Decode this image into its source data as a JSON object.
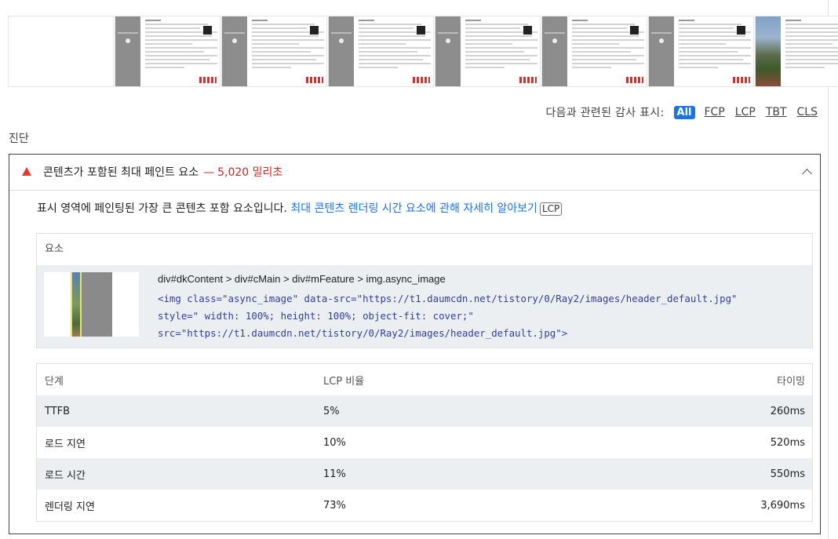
{
  "filter": {
    "label": "다음과 관련된 감사 표시:",
    "options": [
      "All",
      "FCP",
      "LCP",
      "TBT",
      "CLS"
    ]
  },
  "section_title": "진단",
  "audit": {
    "title": "콘텐츠가 포함된 최대 페인트 요소",
    "dash": "—",
    "value": "5,020 밀리초",
    "description": "표시 영역에 페인팅된 가장 큰 콘텐츠 포함 요소입니다.",
    "learn_more": "최대 콘텐츠 렌더링 시간 요소에 관해 자세히 알아보기",
    "badge": "LCP",
    "element_header": "요소",
    "element_path": "div#dkContent > div#cMain > div#mFeature > img.async_image",
    "element_code_1": "<img class=\"async_image\" data-src=\"https://t1.daumcdn.net/tistory/0/Ray2/images/header_default.jpg\"",
    "element_code_2": "style=\" width: 100%; height: 100%; object-fit: cover;\"",
    "element_code_3": "src=\"https://t1.daumcdn.net/tistory/0/Ray2/images/header_default.jpg\">"
  },
  "table": {
    "headers": [
      "단계",
      "LCP 비율",
      "타이밍"
    ],
    "rows": [
      [
        "TTFB",
        "5%",
        "260ms"
      ],
      [
        "로드 지연",
        "10%",
        "520ms"
      ],
      [
        "로드 시간",
        "11%",
        "550ms"
      ],
      [
        "렌더링 지연",
        "73%",
        "3,690ms"
      ]
    ]
  },
  "colors": {
    "accent": "#1a73e8",
    "fail": "#c62828"
  }
}
